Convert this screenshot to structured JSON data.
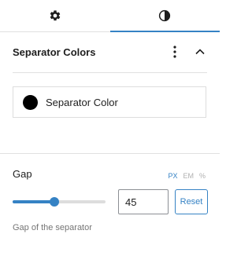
{
  "tabs": [
    {
      "icon": "gear-icon",
      "active": false
    },
    {
      "icon": "contrast-icon",
      "active": true
    }
  ],
  "panel": {
    "title": "Separator Colors"
  },
  "color_item": {
    "label": "Separator Color",
    "swatch_color": "#000000"
  },
  "gap": {
    "label": "Gap",
    "units": [
      "PX",
      "EM",
      "%"
    ],
    "active_unit": "PX",
    "value": "45",
    "slider_fraction": 0.45,
    "reset_label": "Reset",
    "help": "Gap of the separator"
  },
  "colors": {
    "accent": "#3582c4",
    "text": "#1e1e1e",
    "muted": "#757575",
    "border": "#e0e0e0"
  }
}
